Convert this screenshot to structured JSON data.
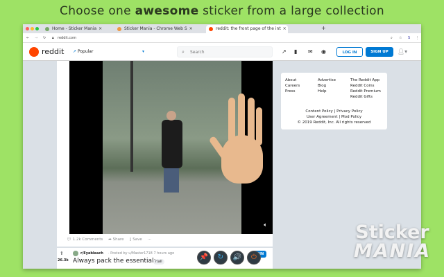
{
  "headline": {
    "pre": "Choose one ",
    "bold": "awesome",
    "post": " sticker from a large collection"
  },
  "browser": {
    "tabs": [
      {
        "label": "Home - Sticker Mania"
      },
      {
        "label": "Sticker Mania - Chrome Web S"
      },
      {
        "label": "reddit: the front page of the int"
      }
    ],
    "url": "reddit.com"
  },
  "reddit": {
    "logo": "reddit",
    "feed": "Popular",
    "search_placeholder": "Search",
    "login": "LOG IN",
    "signup": "SIGN UP"
  },
  "post": {
    "comments": "1.2k Comments",
    "share": "Share",
    "save": "Save",
    "more": "···"
  },
  "sidebar": {
    "col1": [
      "About",
      "Careers",
      "Press"
    ],
    "col2": [
      "Advertise",
      "Blog",
      "Help"
    ],
    "col3": [
      "The Reddit App",
      "Reddit Coins",
      "Reddit Premium",
      "Reddit Gifts"
    ],
    "footer": [
      "Content Policy | Privacy Policy",
      "User Agreement | Mod Policy",
      "© 2019 Reddit, Inc. All rights reserved"
    ]
  },
  "post2": {
    "votes": "26.3k",
    "subreddit": "r/Eyebleach",
    "meta": "· Posted by u/Master1718 7 hours ago",
    "title": "Always pack the essentials.",
    "flair": "r/all",
    "join": "JOIN"
  },
  "sticker_toolbar": [
    {
      "icon": "pin-icon",
      "glyph": "📌"
    },
    {
      "icon": "refresh-icon",
      "glyph": "↻"
    },
    {
      "icon": "volume-icon",
      "glyph": "🔊"
    },
    {
      "icon": "power-icon",
      "glyph": "⏻"
    }
  ],
  "brand": {
    "line1": "Sticker",
    "line2": "MANIA"
  },
  "colors": {
    "background": "#9ee265",
    "reddit_orange": "#ff4500",
    "reddit_blue": "#0079d3"
  }
}
